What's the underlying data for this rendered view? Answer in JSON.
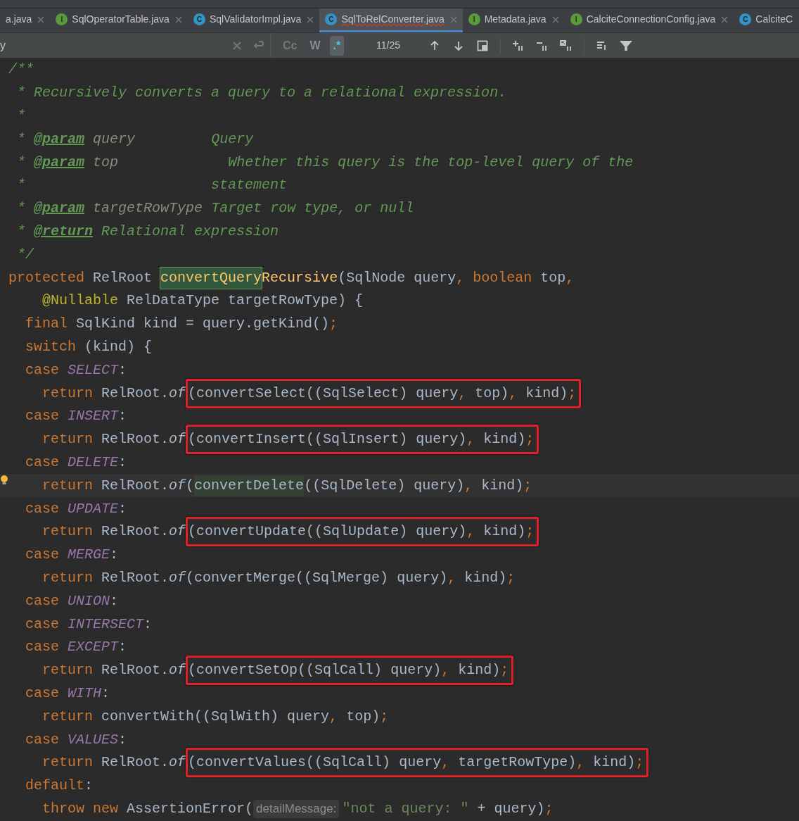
{
  "tabs": [
    {
      "label": "a.java",
      "selected": false,
      "has_errors": false
    },
    {
      "label": "SqlOperatorTable.java",
      "icon": "I",
      "kind": "interface",
      "selected": false,
      "has_errors": false
    },
    {
      "label": "SqlValidatorImpl.java",
      "icon": "C",
      "kind": "class",
      "selected": false,
      "has_errors": false
    },
    {
      "label": "SqlToRelConverter.java",
      "icon": "C",
      "kind": "class",
      "selected": true,
      "has_errors": true
    },
    {
      "label": "Metadata.java",
      "icon": "I",
      "kind": "interface",
      "selected": false,
      "has_errors": false
    },
    {
      "label": "CalciteConnectionConfig.java",
      "icon": "I",
      "kind": "interface",
      "selected": false,
      "has_errors": false
    },
    {
      "label": "CalciteC",
      "icon": "C",
      "kind": "class",
      "selected": false,
      "has_errors": false
    }
  ],
  "search": {
    "value": "y",
    "toggles": [
      {
        "label": "Cc",
        "selected": false,
        "disabled": false
      },
      {
        "label": "W",
        "selected": false,
        "disabled": true
      },
      {
        "label": ".*",
        "selected": true,
        "disabled": false
      }
    ],
    "match_count": "11/25"
  },
  "lines": [
    {
      "tokens": [
        {
          "kind": "comment",
          "text": "/**"
        }
      ]
    },
    {
      "tokens": [
        {
          "kind": "comment",
          "text": " * Recursively converts a query to a relational expression."
        }
      ]
    },
    {
      "tokens": [
        {
          "kind": "comment",
          "text": " *"
        }
      ]
    },
    {
      "tokens": [
        {
          "kind": "comment",
          "text": " * "
        },
        {
          "kind": "doctag",
          "text": "@param"
        },
        {
          "kind": "docparam",
          "text": " query"
        },
        {
          "kind": "comment",
          "text": "         Query"
        }
      ]
    },
    {
      "tokens": [
        {
          "kind": "comment",
          "text": " * "
        },
        {
          "kind": "doctag",
          "text": "@param"
        },
        {
          "kind": "docparam",
          "text": " top"
        },
        {
          "kind": "comment",
          "text": "             Whether this query is the top-level query of the"
        }
      ]
    },
    {
      "tokens": [
        {
          "kind": "comment",
          "text": " *                      statement"
        }
      ]
    },
    {
      "tokens": [
        {
          "kind": "comment",
          "text": " * "
        },
        {
          "kind": "doctag",
          "text": "@param"
        },
        {
          "kind": "docparam",
          "text": " targetRowType"
        },
        {
          "kind": "comment",
          "text": " Target row type, or null"
        }
      ]
    },
    {
      "tokens": [
        {
          "kind": "comment",
          "text": " * "
        },
        {
          "kind": "doctag",
          "text": "@return"
        },
        {
          "kind": "comment",
          "text": " Relational expression"
        }
      ]
    },
    {
      "tokens": [
        {
          "kind": "comment",
          "text": " */"
        }
      ]
    },
    {
      "tokens": [
        {
          "kind": "kw",
          "text": "protected"
        },
        {
          "kind": "plain",
          "text": " RelRoot "
        },
        {
          "kind": "match",
          "text": "convertQuery"
        },
        {
          "kind": "decl",
          "text": "Recursive"
        },
        {
          "kind": "plain",
          "text": "(SqlNode query"
        },
        {
          "kind": "kw",
          "text": ", boolean"
        },
        {
          "kind": "plain",
          "text": " top"
        },
        {
          "kind": "kw",
          "text": ","
        }
      ]
    },
    {
      "tokens": [
        {
          "kind": "annotation",
          "text": "    @Nullable"
        },
        {
          "kind": "plain",
          "text": " RelDataType targetRowType) {"
        }
      ]
    },
    {
      "tokens": [
        {
          "kind": "kw",
          "text": "  final"
        },
        {
          "kind": "plain",
          "text": " SqlKind kind = query.getKind()"
        },
        {
          "kind": "kw",
          "text": ";"
        }
      ]
    },
    {
      "tokens": [
        {
          "kind": "kw",
          "text": "  switch"
        },
        {
          "kind": "plain",
          "text": " (kind) {"
        }
      ]
    },
    {
      "tokens": [
        {
          "kind": "kw",
          "text": "  case "
        },
        {
          "kind": "constant",
          "text": "SELECT"
        },
        {
          "kind": "plain",
          "text": ":"
        }
      ]
    },
    {
      "tokens": [
        {
          "kind": "kw",
          "text": "    return"
        },
        {
          "kind": "plain",
          "text": " RelRoot."
        },
        {
          "kind": "static",
          "text": "of"
        },
        {
          "kind": "box",
          "tokens": [
            {
              "kind": "plain",
              "text": "(convertSelect((SqlSelect) query"
            },
            {
              "kind": "kw",
              "text": ", "
            },
            {
              "kind": "plain",
              "text": "top)"
            },
            {
              "kind": "kw",
              "text": ", "
            },
            {
              "kind": "plain",
              "text": "kind)"
            },
            {
              "kind": "kw",
              "text": ";"
            }
          ]
        }
      ]
    },
    {
      "tokens": [
        {
          "kind": "kw",
          "text": "  case "
        },
        {
          "kind": "constant",
          "text": "INSERT"
        },
        {
          "kind": "plain",
          "text": ":"
        }
      ]
    },
    {
      "tokens": [
        {
          "kind": "kw",
          "text": "    return"
        },
        {
          "kind": "plain",
          "text": " RelRoot."
        },
        {
          "kind": "static",
          "text": "of"
        },
        {
          "kind": "box",
          "tokens": [
            {
              "kind": "plain",
              "text": "(convertInsert((SqlInsert) query)"
            },
            {
              "kind": "kw",
              "text": ", "
            },
            {
              "kind": "plain",
              "text": "kind)"
            },
            {
              "kind": "kw",
              "text": ";"
            }
          ]
        }
      ]
    },
    {
      "tokens": [
        {
          "kind": "kw",
          "text": "  case "
        },
        {
          "kind": "constant",
          "text": "DELETE"
        },
        {
          "kind": "plain",
          "text": ":"
        }
      ]
    },
    {
      "current": true,
      "intention": true,
      "tokens": [
        {
          "kind": "kw",
          "text": "    return"
        },
        {
          "kind": "plain",
          "text": " RelRoot."
        },
        {
          "kind": "static",
          "text": "of"
        },
        {
          "kind": "plain",
          "text": "("
        },
        {
          "kind": "usage",
          "text": "convertDelete"
        },
        {
          "kind": "plain",
          "text": "((SqlDelete) query)"
        },
        {
          "kind": "kw",
          "text": ", "
        },
        {
          "kind": "plain",
          "text": "kind)"
        },
        {
          "kind": "kw",
          "text": ";"
        }
      ]
    },
    {
      "tokens": [
        {
          "kind": "kw",
          "text": "  case "
        },
        {
          "kind": "constant",
          "text": "UPDATE"
        },
        {
          "kind": "plain",
          "text": ":"
        }
      ]
    },
    {
      "tokens": [
        {
          "kind": "kw",
          "text": "    return"
        },
        {
          "kind": "plain",
          "text": " RelRoot."
        },
        {
          "kind": "static",
          "text": "of"
        },
        {
          "kind": "box",
          "tokens": [
            {
              "kind": "plain",
              "text": "(convertUpdate((SqlUpdate) query)"
            },
            {
              "kind": "kw",
              "text": ", "
            },
            {
              "kind": "plain",
              "text": "kind)"
            },
            {
              "kind": "kw",
              "text": ";"
            }
          ]
        }
      ]
    },
    {
      "tokens": [
        {
          "kind": "kw",
          "text": "  case "
        },
        {
          "kind": "constant",
          "text": "MERGE"
        },
        {
          "kind": "plain",
          "text": ":"
        }
      ]
    },
    {
      "tokens": [
        {
          "kind": "kw",
          "text": "    return"
        },
        {
          "kind": "plain",
          "text": " RelRoot."
        },
        {
          "kind": "static",
          "text": "of"
        },
        {
          "kind": "plain",
          "text": "(convertMerge((SqlMerge) query)"
        },
        {
          "kind": "kw",
          "text": ", "
        },
        {
          "kind": "plain",
          "text": "kind)"
        },
        {
          "kind": "kw",
          "text": ";"
        }
      ]
    },
    {
      "tokens": [
        {
          "kind": "kw",
          "text": "  case "
        },
        {
          "kind": "constant",
          "text": "UNION"
        },
        {
          "kind": "plain",
          "text": ":"
        }
      ]
    },
    {
      "tokens": [
        {
          "kind": "kw",
          "text": "  case "
        },
        {
          "kind": "constant",
          "text": "INTERSECT"
        },
        {
          "kind": "plain",
          "text": ":"
        }
      ]
    },
    {
      "tokens": [
        {
          "kind": "kw",
          "text": "  case "
        },
        {
          "kind": "constant",
          "text": "EXCEPT"
        },
        {
          "kind": "plain",
          "text": ":"
        }
      ]
    },
    {
      "tokens": [
        {
          "kind": "kw",
          "text": "    return"
        },
        {
          "kind": "plain",
          "text": " RelRoot."
        },
        {
          "kind": "static",
          "text": "of"
        },
        {
          "kind": "box",
          "tokens": [
            {
              "kind": "plain",
              "text": "(convertSetOp((SqlCall) query)"
            },
            {
              "kind": "kw",
              "text": ", "
            },
            {
              "kind": "plain",
              "text": "kind)"
            },
            {
              "kind": "kw",
              "text": ";"
            }
          ]
        }
      ]
    },
    {
      "tokens": [
        {
          "kind": "kw",
          "text": "  case "
        },
        {
          "kind": "constant",
          "text": "WITH"
        },
        {
          "kind": "plain",
          "text": ":"
        }
      ]
    },
    {
      "tokens": [
        {
          "kind": "kw",
          "text": "    return"
        },
        {
          "kind": "plain",
          "text": " convertWith((SqlWith) query"
        },
        {
          "kind": "kw",
          "text": ", "
        },
        {
          "kind": "plain",
          "text": "top)"
        },
        {
          "kind": "kw",
          "text": ";"
        }
      ]
    },
    {
      "tokens": [
        {
          "kind": "kw",
          "text": "  case "
        },
        {
          "kind": "constant",
          "text": "VALUES"
        },
        {
          "kind": "plain",
          "text": ":"
        }
      ]
    },
    {
      "tokens": [
        {
          "kind": "kw",
          "text": "    return"
        },
        {
          "kind": "plain",
          "text": " RelRoot."
        },
        {
          "kind": "static",
          "text": "of"
        },
        {
          "kind": "box",
          "tokens": [
            {
              "kind": "plain",
              "text": "(convertValues((SqlCall) query"
            },
            {
              "kind": "kw",
              "text": ", "
            },
            {
              "kind": "plain",
              "text": "targetRowType)"
            },
            {
              "kind": "kw",
              "text": ", "
            },
            {
              "kind": "plain",
              "text": "kind)"
            },
            {
              "kind": "kw",
              "text": ";"
            }
          ]
        }
      ]
    },
    {
      "tokens": [
        {
          "kind": "kw",
          "text": "  default"
        },
        {
          "kind": "plain",
          "text": ":"
        }
      ]
    },
    {
      "tokens": [
        {
          "kind": "kw",
          "text": "    throw new"
        },
        {
          "kind": "plain",
          "text": " AssertionError("
        },
        {
          "kind": "hint",
          "text": "detailMessage:"
        },
        {
          "kind": "string",
          "text": "\"not a query: \""
        },
        {
          "kind": "plain",
          "text": " + query)"
        },
        {
          "kind": "kw",
          "text": ";"
        }
      ]
    }
  ]
}
